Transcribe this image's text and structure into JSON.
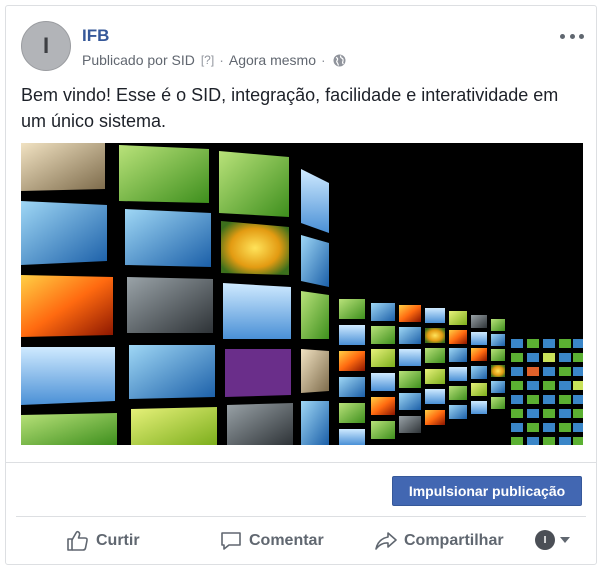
{
  "post": {
    "avatar_letter": "I",
    "page_name": "IFB",
    "published_by": "Publicado por SID",
    "help": "[?]",
    "time": "Agora mesmo",
    "separator": "·",
    "text": "Bem vindo! Esse é o SID, integração, facilidade e interatividade em um único sistema.",
    "image_icon": "video-wall-image"
  },
  "boost_button": {
    "label": "Impulsionar publicação",
    "color": "#4267b2"
  },
  "actions": {
    "like": "Curtir",
    "comment": "Comentar",
    "share": "Compartilhar",
    "audience_letter": "I"
  },
  "colors": {
    "link": "#365899",
    "meta": "#616770",
    "border": "#dddfe2"
  }
}
